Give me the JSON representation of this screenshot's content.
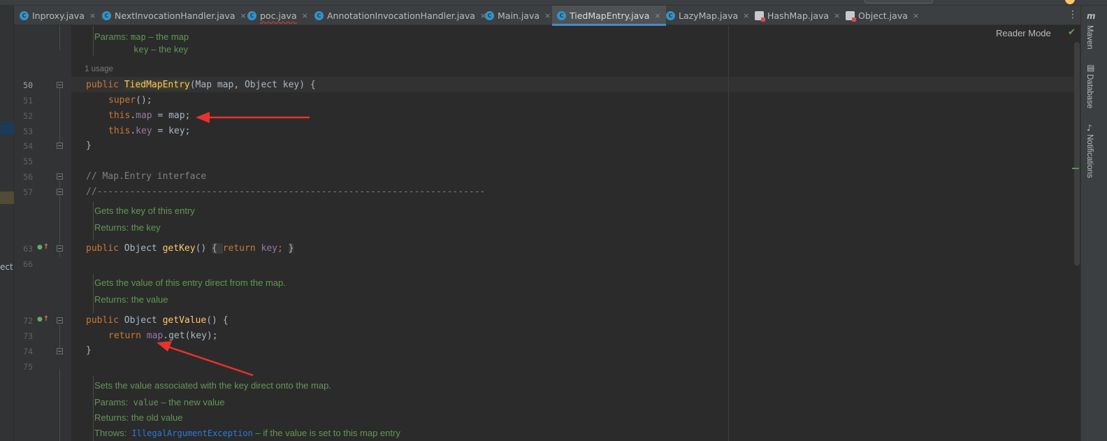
{
  "tabs": [
    {
      "label": "Inproxy.java",
      "icon": "class-icon"
    },
    {
      "label": "NextInvocationHandler.java",
      "icon": "class-icon"
    },
    {
      "label": "poc.java",
      "icon": "class-icon"
    },
    {
      "label": "AnnotationInvocationHandler.java",
      "icon": "class-icon"
    },
    {
      "label": "Main.java",
      "icon": "class-icon"
    },
    {
      "label": "TiedMapEntry.java",
      "icon": "class-icon",
      "active": true
    },
    {
      "label": "LazyMap.java",
      "icon": "class-icon"
    },
    {
      "label": "HashMap.java",
      "icon": "library-class-icon"
    },
    {
      "label": "Object.java",
      "icon": "library-class-icon"
    }
  ],
  "tab_close_glyph": "×",
  "more_tabs_glyph": "⋮",
  "left_strip_text": "ect",
  "reader_mode_label": "Reader Mode",
  "right_tool_windows": [
    "Maven",
    "Database",
    "Notifications"
  ],
  "maven_glyph": "m",
  "editor": {
    "usage_hint": "1 usage",
    "doc_params_1": {
      "prefix": "Params: ",
      "p1": "map",
      "p1_desc": " – the map",
      "p2": "key",
      "p2_desc": " – the key"
    },
    "line_numbers": [
      "50",
      "51",
      "52",
      "53",
      "54",
      "55",
      "56",
      "57",
      "63",
      "66",
      "72",
      "73",
      "74",
      "75"
    ],
    "code": {
      "l50_kw": "public ",
      "l50_name": "TiedMapEntry",
      "l50_rest": "(Map map, Object key) {",
      "l51_kw": "super",
      "l51_rest": "();",
      "l52_kw": "this",
      "l52_dot": ".",
      "l52_fld": "map",
      "l52_rest": " = map;",
      "l53_kw": "this",
      "l53_dot": ".",
      "l53_fld": "key",
      "l53_rest": " = key;",
      "l54": "}",
      "l56": "// Map.Entry interface",
      "l57": "//-----------------------------------------------------------------------",
      "l63_kw": "public ",
      "l63_type": "Object ",
      "l63_name": "getKey",
      "l63_paren": "() ",
      "l63_open": "{ ",
      "l63_ret": "return ",
      "l63_fld": "key",
      "l63_semi": "; ",
      "l63_close": "}",
      "l72_kw": "public ",
      "l72_type": "Object ",
      "l72_name": "getValue",
      "l72_rest": "() {",
      "l73_ret": "return ",
      "l73_fld": "map",
      "l73_rest": ".get(key);",
      "l74": "}"
    },
    "doc_getkey": {
      "line1": "Gets the key of this entry",
      "line2": "Returns: the key"
    },
    "doc_getvalue": {
      "line1": "Gets the value of this entry direct from the map.",
      "line2": "Returns: the value"
    },
    "doc_setvalue": {
      "line1": "Sets the value associated with the key direct onto the map.",
      "params_prefix": "Params:  ",
      "params_name": "value",
      "params_desc": " – the new value",
      "returns": "Returns: the old value",
      "throws_prefix": "Throws:  ",
      "throws_link": "IllegalArgumentException",
      "throws_desc": " – if the value is set to this map entry"
    }
  },
  "colors": {
    "background": "#2b2b2b",
    "keyword": "#cc7832",
    "field": "#9876aa",
    "method": "#ffc66d",
    "doc_comment": "#629755",
    "annotation_arrow": "#e8322d"
  }
}
